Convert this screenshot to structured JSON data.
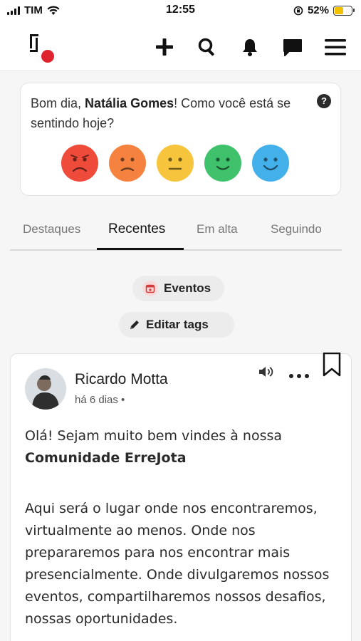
{
  "status_bar": {
    "carrier": "TIM",
    "time": "12:55",
    "battery_percent": "52%",
    "battery_level": 0.52
  },
  "header": {
    "icons": [
      "plus-icon",
      "search-icon",
      "bell-icon",
      "chat-icon",
      "menu-icon"
    ],
    "logo_badge_color": "#e0242f"
  },
  "mood": {
    "greeting": "Bom dia, ",
    "user_name": "Natália Gomes",
    "question": "! Como você está se sentindo hoje?",
    "help_label": "?",
    "faces": [
      {
        "name": "very-sad",
        "color": "#ee4b3a"
      },
      {
        "name": "sad",
        "color": "#f5833f"
      },
      {
        "name": "neutral",
        "color": "#f6c53d"
      },
      {
        "name": "happy",
        "color": "#3fc26b"
      },
      {
        "name": "very-happy",
        "color": "#43b0ea"
      }
    ]
  },
  "tabs": [
    {
      "label": "Destaques",
      "active": false
    },
    {
      "label": "Recentes",
      "active": true
    },
    {
      "label": "Em alta",
      "active": false
    },
    {
      "label": "Seguindo",
      "active": false
    }
  ],
  "chips": {
    "events_label": "Eventos",
    "edit_tags_label": "Editar tags"
  },
  "post": {
    "author": "Ricardo Motta",
    "time": "há 6 dias •",
    "intro": "Olá! Sejam muito bem vindes à nossa",
    "community": "Comunidade ErreJota",
    "body": "Aqui será o lugar onde nos encontraremos, virtualmente ao menos. Onde nos prepararemos para nos encontrar mais presencialmente. Onde divulgaremos nossos eventos, compartilharemos nossos desafios, nossas oportunidades."
  }
}
